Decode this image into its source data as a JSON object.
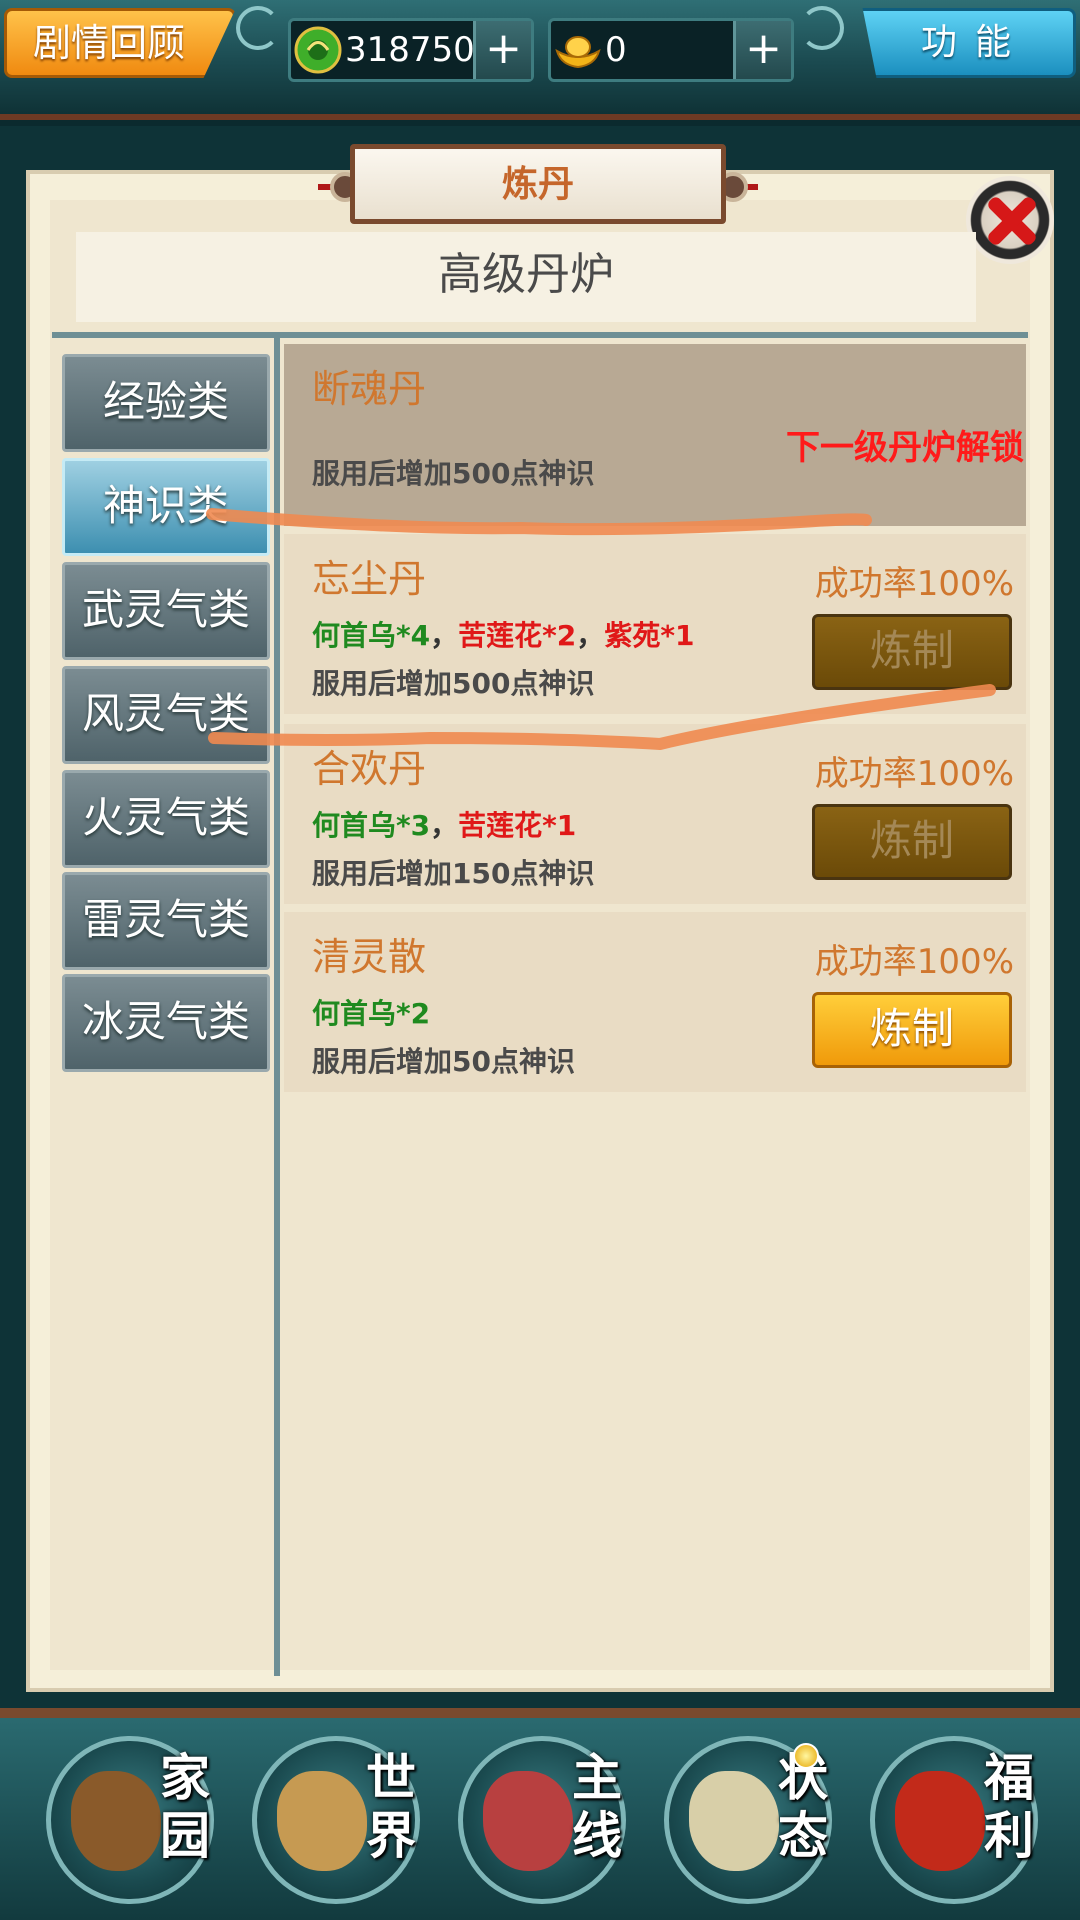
{
  "topbar": {
    "story_label": "剧情回顾",
    "function_label": "功能",
    "jade_value": "318750",
    "gold_value": "0",
    "plus_label": "+"
  },
  "panel": {
    "title": "炼丹",
    "furnace_name": "高级丹炉"
  },
  "categories": [
    {
      "label": "经验类",
      "active": false
    },
    {
      "label": "神识类",
      "active": true
    },
    {
      "label": "武灵气类",
      "active": false
    },
    {
      "label": "风灵气类",
      "active": false
    },
    {
      "label": "火灵气类",
      "active": false
    },
    {
      "label": "雷灵气类",
      "active": false
    },
    {
      "label": "冰灵气类",
      "active": false
    }
  ],
  "recipes": [
    {
      "name": "断魂丹",
      "locked": true,
      "lock_text": "下一级丹炉解锁",
      "description": "服用后增加500点神识"
    },
    {
      "name": "忘尘丹",
      "success_rate": "成功率100%",
      "materials": [
        {
          "text": "何首乌*4",
          "color": "green"
        },
        {
          "text": "，",
          "color": "sep"
        },
        {
          "text": "苦莲花*2",
          "color": "red"
        },
        {
          "text": "，",
          "color": "sep"
        },
        {
          "text": "紫苑*1",
          "color": "red"
        }
      ],
      "description": "服用后增加500点神识",
      "button_label": "炼制",
      "button_enabled": false
    },
    {
      "name": "合欢丹",
      "success_rate": "成功率100%",
      "materials": [
        {
          "text": "何首乌*3",
          "color": "green"
        },
        {
          "text": "，",
          "color": "sep"
        },
        {
          "text": "苦莲花*1",
          "color": "red"
        }
      ],
      "description": "服用后增加150点神识",
      "button_label": "炼制",
      "button_enabled": false
    },
    {
      "name": "清灵散",
      "success_rate": "成功率100%",
      "materials": [
        {
          "text": "何首乌*2",
          "color": "green"
        }
      ],
      "description": "服用后增加50点神识",
      "button_label": "炼制",
      "button_enabled": true
    }
  ],
  "bottom_nav": [
    {
      "label": "家园",
      "icon": "home-icon",
      "art_color": "#8a5a2a"
    },
    {
      "label": "世界",
      "icon": "world-icon",
      "art_color": "#c69a52"
    },
    {
      "label": "主线",
      "icon": "mainline-icon",
      "art_color": "#b84040"
    },
    {
      "label": "状态",
      "icon": "status-icon",
      "art_color": "#d8cfa8",
      "notify": true
    },
    {
      "label": "福利",
      "icon": "welfare-icon",
      "art_color": "#c22a1a"
    }
  ],
  "colors": {
    "accent_orange": "#f08a10",
    "accent_blue": "#1b8fbf",
    "recipe_name": "#d0772e",
    "material_have": "#1f8a1f",
    "material_missing": "#e01818",
    "annotation_stroke": "#f08a50"
  }
}
